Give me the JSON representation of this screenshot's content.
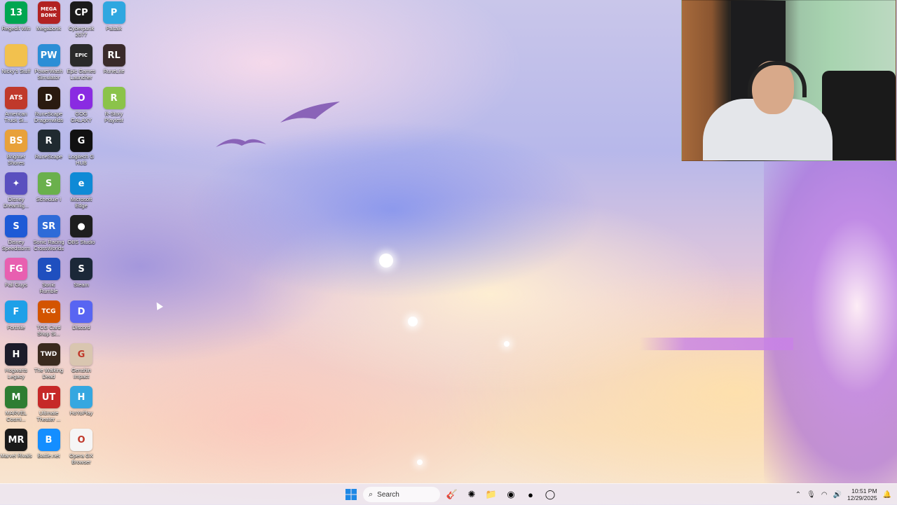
{
  "desktop": {
    "icons": [
      {
        "label": "Regedit Win",
        "name": "regedit-win-icon",
        "text": "13",
        "color": "#00a651",
        "empty": false
      },
      {
        "label": "Megabonk",
        "name": "megabonk-icon",
        "text": "MEGA\nBONK",
        "color": "#b22222",
        "empty": false
      },
      {
        "label": "Cyberpunk\n2077",
        "name": "cyberpunk-2077-icon",
        "text": "CP",
        "color": "#1a1a1a",
        "empty": false
      },
      {
        "label": "Paltalk",
        "name": "paltalk-icon",
        "text": "P",
        "color": "#2fa7e0",
        "empty": false
      },
      {
        "label": "Nicky's Stuff",
        "name": "folder-icon",
        "text": "",
        "color": "#f2c14e",
        "empty": false
      },
      {
        "label": "PowerWash\nSimulator",
        "name": "powerwash-simulator-icon",
        "text": "PW",
        "color": "#2b8ed6",
        "empty": false
      },
      {
        "label": "Epic Games\nLauncher",
        "name": "epic-games-launcher-icon",
        "text": "EPIC",
        "color": "#2a2a2a",
        "empty": false
      },
      {
        "label": "RuneLite",
        "name": "runelite-icon",
        "text": "RL",
        "color": "#3a2a2a",
        "empty": false
      },
      {
        "label": "American\nTruck Si...",
        "name": "american-truck-simulator-icon",
        "text": "ATS",
        "color": "#c0392b",
        "empty": false
      },
      {
        "label": "RuneScape\nDragonwilds",
        "name": "runescape-dragonwilds-icon",
        "text": "D",
        "color": "#2a1a10",
        "empty": false
      },
      {
        "label": "GOG GALAXY",
        "name": "gog-galaxy-icon",
        "text": "O",
        "color": "#8a2be2",
        "empty": false
      },
      {
        "label": "R-Story\nPlaytest",
        "name": "r-story-playtest-icon",
        "text": "R",
        "color": "#8bc34a",
        "empty": false
      },
      {
        "label": "Brighter\nShores",
        "name": "brighter-shores-icon",
        "text": "BS",
        "color": "#e8a13a",
        "empty": false
      },
      {
        "label": "RuneScape",
        "name": "runescape-icon",
        "text": "R",
        "color": "#202a30",
        "empty": false
      },
      {
        "label": "Logitech G\nHUB",
        "name": "logitech-g-hub-icon",
        "text": "G",
        "color": "#111111",
        "empty": false
      },
      {
        "label": "",
        "name": "empty-slot",
        "text": "",
        "color": "#000",
        "empty": true
      },
      {
        "label": "Disney\nDreamlig...",
        "name": "disney-dreamlight-icon",
        "text": "✦",
        "color": "#5a4fbf",
        "empty": false
      },
      {
        "label": "Schedule I",
        "name": "schedule-i-icon",
        "text": "S",
        "color": "#6ab04c",
        "empty": false
      },
      {
        "label": "Microsoft\nEdge",
        "name": "microsoft-edge-icon",
        "text": "e",
        "color": "#0f8ad6",
        "empty": false
      },
      {
        "label": "",
        "name": "empty-slot",
        "text": "",
        "color": "#000",
        "empty": true
      },
      {
        "label": "Disney\nSpeedstorm",
        "name": "disney-speedstorm-icon",
        "text": "S",
        "color": "#1e5ad6",
        "empty": false
      },
      {
        "label": "Sonic Racing\nCrossWorlds",
        "name": "sonic-racing-crossworlds-icon",
        "text": "SR",
        "color": "#2f6bd8",
        "empty": false
      },
      {
        "label": "OBS Studio",
        "name": "obs-studio-icon",
        "text": "●",
        "color": "#1e1e1e",
        "empty": false
      },
      {
        "label": "",
        "name": "empty-slot",
        "text": "",
        "color": "#000",
        "empty": true
      },
      {
        "label": "Fall Guys",
        "name": "fall-guys-icon",
        "text": "FG",
        "color": "#e85fb0",
        "empty": false
      },
      {
        "label": "Sonic\nRumble",
        "name": "sonic-rumble-icon",
        "text": "S",
        "color": "#1f4fbf",
        "empty": false
      },
      {
        "label": "Steam",
        "name": "steam-icon",
        "text": "S",
        "color": "#1b2838",
        "empty": false
      },
      {
        "label": "",
        "name": "empty-slot",
        "text": "",
        "color": "#000",
        "empty": true
      },
      {
        "label": "Fortnite",
        "name": "fortnite-icon",
        "text": "F",
        "color": "#1ea0e8",
        "empty": false
      },
      {
        "label": "TCG Card\nShop Si...",
        "name": "tcg-card-shop-icon",
        "text": "TCG",
        "color": "#d35400",
        "empty": false
      },
      {
        "label": "Discord",
        "name": "discord-icon",
        "text": "D",
        "color": "#5865f2",
        "empty": false
      },
      {
        "label": "",
        "name": "empty-slot",
        "text": "",
        "color": "#000",
        "empty": true
      },
      {
        "label": "Hogwarts\nLegacy",
        "name": "hogwarts-legacy-icon",
        "text": "H",
        "color": "#1c1c2a",
        "empty": false
      },
      {
        "label": "The Walking\nDead",
        "name": "the-walking-dead-icon",
        "text": "TWD",
        "color": "#3a2a1e",
        "empty": false
      },
      {
        "label": "Genshin\nImpact",
        "name": "genshin-impact-icon",
        "text": "G",
        "color": "#d9c6b0",
        "empty": false
      },
      {
        "label": "",
        "name": "empty-slot",
        "text": "",
        "color": "#000",
        "empty": true
      },
      {
        "label": "MARVEL\nCosmi...",
        "name": "marvel-cosmic-icon",
        "text": "M",
        "color": "#2e7d32",
        "empty": false
      },
      {
        "label": "Ultimate\nTheater ...",
        "name": "ultimate-theater-icon",
        "text": "UT",
        "color": "#c62828",
        "empty": false
      },
      {
        "label": "HoYoPlay",
        "name": "hoyoplay-icon",
        "text": "H",
        "color": "#35a7e0",
        "empty": false
      },
      {
        "label": "",
        "name": "empty-slot",
        "text": "",
        "color": "#000",
        "empty": true
      },
      {
        "label": "Marvel Rivals",
        "name": "marvel-rivals-icon",
        "text": "MR",
        "color": "#1a1a1a",
        "empty": false
      },
      {
        "label": "Battle.net",
        "name": "battle-net-icon",
        "text": "B",
        "color": "#148eff",
        "empty": false
      },
      {
        "label": "Opera GX\nBrowser",
        "name": "opera-gx-browser-icon",
        "text": "O",
        "color": "#f5f5f5",
        "empty": false
      }
    ]
  },
  "taskbar": {
    "search_placeholder": "Search",
    "start_icon": "windows-start-icon",
    "pinned": [
      {
        "name": "guitar-app-icon",
        "glyph": "🎸"
      },
      {
        "name": "copilot-icon",
        "glyph": "✺"
      },
      {
        "name": "file-explorer-icon",
        "glyph": "📁"
      },
      {
        "name": "discord-taskbar-icon",
        "glyph": "◉"
      },
      {
        "name": "game-app-icon",
        "glyph": "●"
      },
      {
        "name": "opera-gx-taskbar-icon",
        "glyph": "◯"
      }
    ],
    "tray_icons": [
      {
        "name": "chevron-up-icon",
        "glyph": "⌃"
      },
      {
        "name": "microphone-icon",
        "glyph": "🎙"
      },
      {
        "name": "wifi-icon",
        "glyph": "◠"
      },
      {
        "name": "volume-icon",
        "glyph": "🔊"
      }
    ],
    "time": "10:51 PM",
    "date": "12/29/2025"
  }
}
